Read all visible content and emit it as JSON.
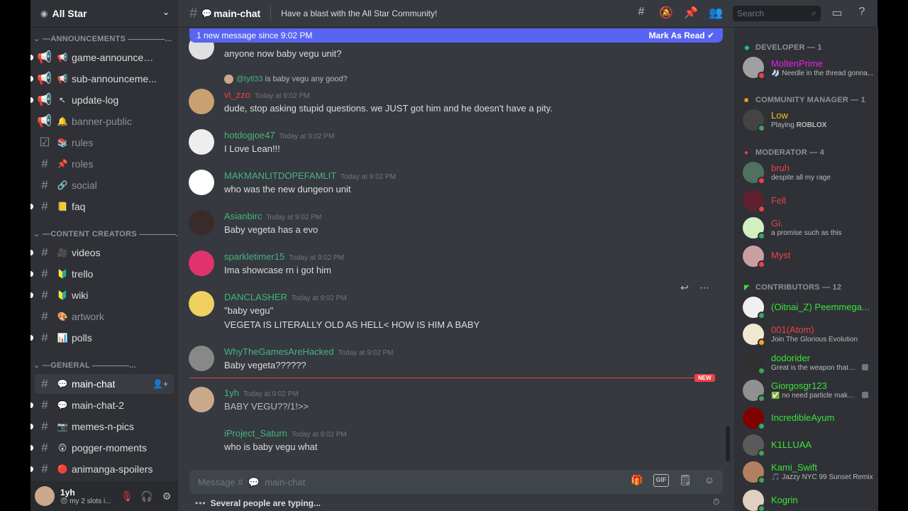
{
  "server": {
    "name": "All Star"
  },
  "categories": {
    "announcements": "ANNOUNCEMENTS",
    "creators": "CONTENT CREATORS",
    "general": "GENERAL"
  },
  "channels": [
    {
      "name": "game-announcem...",
      "emoji": "📢",
      "icon": "megaphone-icon"
    },
    {
      "name": "sub-announceme...",
      "emoji": "📢",
      "icon": "megaphone-icon"
    },
    {
      "name": "update-log",
      "emoji": "↖",
      "icon": "megaphone-icon"
    },
    {
      "name": "banner-public",
      "emoji": "🔔",
      "icon": "megaphone-icon"
    },
    {
      "name": "rules",
      "emoji": "📚",
      "icon": "rules-check-icon"
    },
    {
      "name": "roles",
      "emoji": "📌",
      "icon": "hash-icon"
    },
    {
      "name": "social",
      "emoji": "🔗",
      "icon": "hash-icon"
    },
    {
      "name": "faq",
      "emoji": "📒",
      "icon": "hash-icon"
    },
    {
      "name": "videos",
      "emoji": "🎥",
      "icon": "hash-icon"
    },
    {
      "name": "trello",
      "emoji": "🔰",
      "icon": "hash-icon"
    },
    {
      "name": "wiki",
      "emoji": "🔰",
      "icon": "hash-icon"
    },
    {
      "name": "artwork",
      "emoji": "🎨",
      "icon": "hash-icon"
    },
    {
      "name": "polls",
      "emoji": "📊",
      "icon": "hash-icon"
    },
    {
      "name": "main-chat",
      "emoji": "💬",
      "icon": "hash-icon"
    },
    {
      "name": "main-chat-2",
      "emoji": "💬",
      "icon": "hash-icon"
    },
    {
      "name": "memes-n-pics",
      "emoji": "📷",
      "icon": "hash-icon"
    },
    {
      "name": "pogger-moments",
      "emoji": "😲",
      "icon": "hash-icon"
    },
    {
      "name": "animanga-spoilers",
      "emoji": "🔴",
      "icon": "hash-icon"
    }
  ],
  "user": {
    "name": "1yh",
    "status": "😠 my 2 slots i..."
  },
  "header": {
    "channel": "main-chat",
    "topic": "Have a blast with the All Star Community!",
    "search_placeholder": "Search"
  },
  "banner": {
    "text": "1 new message since 9:02 PM",
    "mark": "Mark As Read"
  },
  "messages": [
    {
      "author": "",
      "time": "",
      "text": "anyone now baby vegu unit?"
    },
    {
      "reply_mention": "@tytl33",
      "reply_text": "is baby vegu any good?",
      "author": "vi_zzo",
      "time": "Today at 9:02 PM",
      "text": "dude, stop asking stupid questions. we JUST got him and he doesn't have a pity.",
      "color": "#ed4245"
    },
    {
      "author": "hotdogjoe47",
      "time": "Today at 9:02 PM",
      "text": "I Love Lean!!!",
      "color": "#43b581"
    },
    {
      "author": "MAKMANLITDOPEFAMLIT",
      "time": "Today at 9:02 PM",
      "text": "who was the new dungeon unit",
      "color": "#43b581"
    },
    {
      "author": "Asianbirc",
      "time": "Today at 9:02 PM",
      "text": "Baby vegeta has a evo",
      "color": "#43b581"
    },
    {
      "author": "sparkletimer15",
      "time": "Today at 9:02 PM",
      "text": "Ima showcase rn i got him",
      "color": "#43b581"
    },
    {
      "author": "DANCLASHER",
      "time": "Today at 9:02 PM",
      "text": "\"baby vegu\"",
      "text2": "VEGETA IS LITERALLY OLD AS HELL< HOW IS HIM A BABY",
      "color": "#43b581"
    },
    {
      "author": "WhyTheGamesAreHacked",
      "time": "Today at 9:02 PM",
      "text": "Baby vegeta??????",
      "color": "#43b581"
    },
    {
      "author": "1yh",
      "time": "Today at 9:02 PM",
      "text": "BABY VEGU??/1!>>",
      "color": "#43b581"
    },
    {
      "author": "iProject_Saturn",
      "time": "Today at 9:02 PM",
      "text": "who is baby vegu what",
      "color": "#43b581"
    }
  ],
  "new_label": "NEW",
  "composer": {
    "placeholder": "Message #  💬  main-chat",
    "gif": "GIF"
  },
  "typing": {
    "text": "Several people are typing..."
  },
  "roles": [
    {
      "label": "DEVELOPER — 1"
    },
    {
      "label": "COMMUNITY MANAGER — 1"
    },
    {
      "label": "MODERATOR — 4"
    },
    {
      "label": "CONTRIBUTORS — 12"
    }
  ],
  "members": [
    {
      "name": "MoltenPrime",
      "status": "🧦 Needle in the thread gonna...",
      "color": "#e91ee9"
    },
    {
      "name": "Low",
      "status": "Playing ROBLOX",
      "color": "#f1c40f"
    },
    {
      "name": "bruh",
      "status": "despite all my rage",
      "color": "#ed4245"
    },
    {
      "name": "Fell",
      "status": "",
      "color": "#ed4245"
    },
    {
      "name": "Gi.",
      "status": "a promise such as this",
      "color": "#ed4245"
    },
    {
      "name": "Myst",
      "status": "",
      "color": "#ed4245"
    },
    {
      "name": "(Oitnai_Z) Peemmega...",
      "status": "",
      "color": "#3ae43a"
    },
    {
      "name": "001(Atom)",
      "status": "Join The Glorious Evolution",
      "color": "#ed4245"
    },
    {
      "name": "dodorider",
      "status": "Great is the weapon that c...",
      "color": "#3ae43a"
    },
    {
      "name": "Giorgosgr123",
      "status": "✅ no need particle maker,...",
      "color": "#3ae43a"
    },
    {
      "name": "IncredibleAyum",
      "status": "",
      "color": "#3ae43a"
    },
    {
      "name": "K1LLUAA",
      "status": "",
      "color": "#3ae43a"
    },
    {
      "name": "Kami_Swift",
      "status": "🎵 Jazzy NYC 99 Sunset Remix",
      "color": "#3ae43a"
    },
    {
      "name": "Kogrin",
      "status": "",
      "color": "#3ae43a"
    }
  ],
  "colors": {
    "accent": "#5865f2",
    "online": "#3ba55d",
    "dnd": "#ed4245",
    "idle": "#faa61a"
  }
}
